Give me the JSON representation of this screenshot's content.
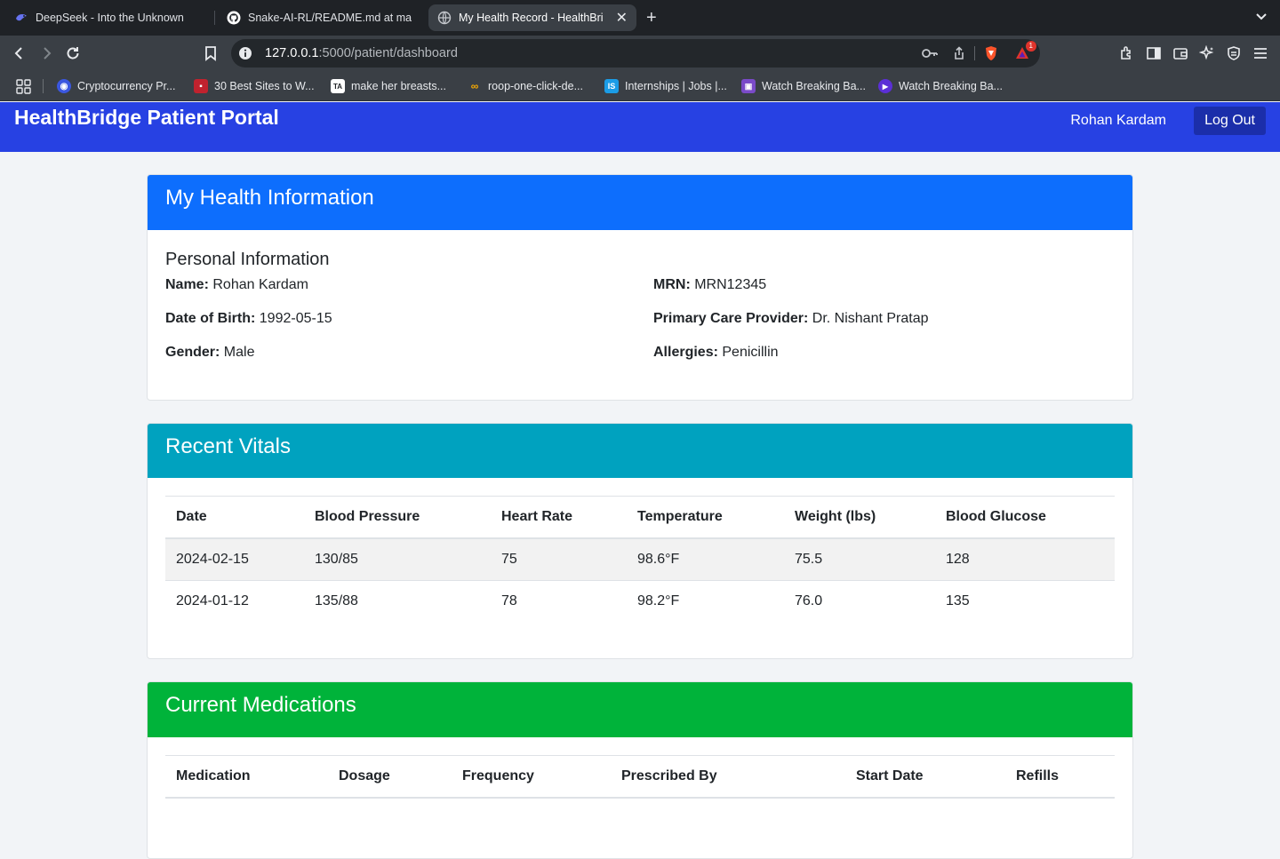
{
  "browser": {
    "tabs": [
      {
        "title": "DeepSeek - Into the Unknown",
        "favicon": "deepseek-icon"
      },
      {
        "title": "Snake-AI-RL/README.md at main",
        "favicon": "github-icon"
      },
      {
        "title": "My Health Record - HealthBridge",
        "favicon": "globe-icon",
        "active": true
      }
    ],
    "url_host": "127.0.0.1",
    "url_path": ":5000/patient/dashboard",
    "shields_badge": "1",
    "bookmarks": [
      {
        "label": "Cryptocurrency Pr...",
        "icon": "crypto-icon"
      },
      {
        "label": "30 Best Sites to W...",
        "icon": "sites-icon"
      },
      {
        "label": "make her breasts...",
        "icon": "ta-icon"
      },
      {
        "label": "roop-one-click-de...",
        "icon": "colab-icon"
      },
      {
        "label": "Internships | Jobs |...",
        "icon": "internshala-icon"
      },
      {
        "label": "Watch Breaking Ba...",
        "icon": "video-icon"
      },
      {
        "label": "Watch Breaking Ba...",
        "icon": "play-icon"
      }
    ]
  },
  "header": {
    "brand": "HealthBridge Patient Portal",
    "user_name": "Rohan Kardam",
    "logout_label": "Log Out",
    "color": "#2741e3"
  },
  "health_info": {
    "title": "My Health Information",
    "color": "#0d6efd",
    "section_title": "Personal Information",
    "fields": [
      {
        "label": "Name:",
        "value": "Rohan Kardam"
      },
      {
        "label": "MRN:",
        "value": "MRN12345"
      },
      {
        "label": "Date of Birth:",
        "value": "1992-05-15"
      },
      {
        "label": "Primary Care Provider:",
        "value": "Dr. Nishant Pratap"
      },
      {
        "label": "Gender:",
        "value": "Male"
      },
      {
        "label": "Allergies:",
        "value": "Penicillin"
      }
    ]
  },
  "vitals": {
    "title": "Recent Vitals",
    "color": "#00a2bf",
    "columns": [
      "Date",
      "Blood Pressure",
      "Heart Rate",
      "Temperature",
      "Weight (lbs)",
      "Blood Glucose"
    ],
    "rows": [
      [
        "2024-02-15",
        "130/85",
        "75",
        "98.6°F",
        "75.5",
        "128"
      ],
      [
        "2024-01-12",
        "135/88",
        "78",
        "98.2°F",
        "76.0",
        "135"
      ]
    ]
  },
  "medications": {
    "title": "Current Medications",
    "color": "#00b33a",
    "columns": [
      "Medication",
      "Dosage",
      "Frequency",
      "Prescribed By",
      "Start Date",
      "Refills"
    ]
  }
}
